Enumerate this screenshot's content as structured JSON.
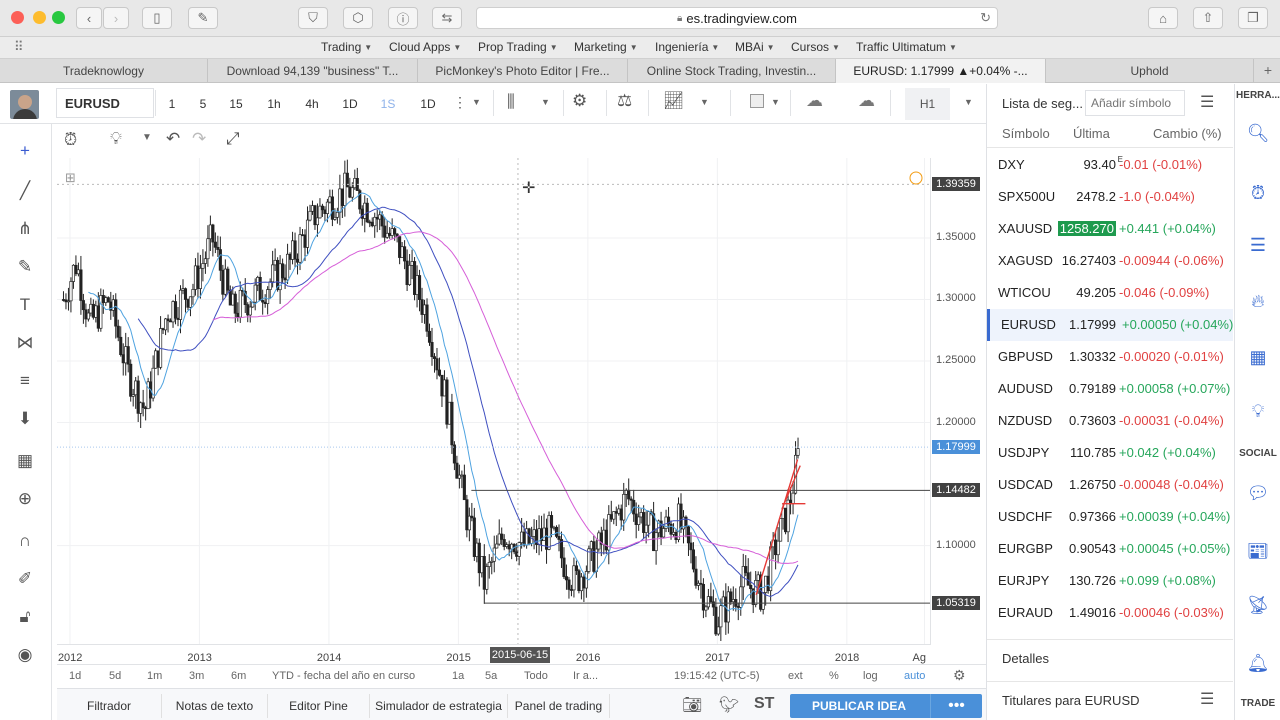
{
  "browser": {
    "url": "es.tradingview.com",
    "bookmarks": [
      {
        "label": "Trading"
      },
      {
        "label": "Cloud Apps"
      },
      {
        "label": "Prop Trading"
      },
      {
        "label": "Marketing"
      },
      {
        "label": "Ingeniería"
      },
      {
        "label": "MBAi"
      },
      {
        "label": "Cursos"
      },
      {
        "label": "Traffic Ultimatum"
      }
    ],
    "tabs": [
      {
        "label": "Tradeknowlogy"
      },
      {
        "label": "Download 94,139 \"business\" T..."
      },
      {
        "label": "PicMonkey's Photo Editor | Fre..."
      },
      {
        "label": "Online Stock Trading, Investin..."
      },
      {
        "label": "EURUSD: 1.17999 ▲+0.04% -..."
      },
      {
        "label": "Uphold"
      }
    ]
  },
  "toolbar": {
    "symbol": "EURUSD",
    "intervals": [
      "1",
      "5",
      "15",
      "1h",
      "4h",
      "1D",
      "1S",
      "1D"
    ],
    "active_interval": "1S",
    "timeframe_label": "H1"
  },
  "chart": {
    "price_labels": {
      "top": "1.39359",
      "current": "1.17999",
      "range_high": "1.14482",
      "range_low": "1.05319"
    },
    "y_ticks": [
      "1.35000",
      "1.30000",
      "1.25000",
      "1.20000",
      "1.10000"
    ],
    "y_values": [
      1.35,
      1.3,
      1.25,
      1.2,
      1.1
    ],
    "x_ticks": [
      "2012",
      "2013",
      "2014",
      "2015",
      "2016",
      "2017",
      "2018",
      "Ag"
    ],
    "x_values": [
      2012,
      2013,
      2014,
      2015,
      2016,
      2017,
      2018,
      2018.6
    ],
    "crosshair_date": "2015-06-15"
  },
  "range_bar": {
    "items": [
      "1d",
      "5d",
      "1m",
      "3m",
      "6m",
      "YTD - fecha del año en curso",
      "1a",
      "5a",
      "Todo",
      "Ir a..."
    ],
    "time": "19:15:42 (UTC-5)",
    "options": [
      "ext",
      "%",
      "log",
      "auto"
    ]
  },
  "bottom_tabs": [
    "Filtrador",
    "Notas de texto",
    "Editor Pine",
    "Simulador de estrategia",
    "Panel de trading"
  ],
  "publish_label": "PUBLICAR IDEA",
  "st_label": "ST",
  "watchlist": {
    "title": "Lista de seg...",
    "add_placeholder": "Añadir símbolo",
    "col_symbol": "Símbolo",
    "col_last": "Última",
    "col_change": "Cambio (%)",
    "rows": [
      {
        "sym": "DXY",
        "last": "93.40",
        "sup": "E",
        "chg": "-0.01 (-0.01%)",
        "dir": "neg"
      },
      {
        "sym": "SPX500U",
        "last": "2478.2",
        "sup": "",
        "chg": "-1.0 (-0.04%)",
        "dir": "neg"
      },
      {
        "sym": "XAUUSD",
        "last": "1258.270",
        "sup": "",
        "chg": "+0.441 (+0.04%)",
        "dir": "pos"
      },
      {
        "sym": "XAGUSD",
        "last": "16.27403",
        "sup": "",
        "chg": "-0.00944 (-0.06%)",
        "dir": "neg"
      },
      {
        "sym": "WTICOU",
        "last": "49.205",
        "sup": "",
        "chg": "-0.046 (-0.09%)",
        "dir": "neg"
      },
      {
        "sym": "EURUSD",
        "last": "1.17999",
        "sup": "",
        "chg": "+0.00050 (+0.04%)",
        "dir": "pos"
      },
      {
        "sym": "GBPUSD",
        "last": "1.30332",
        "sup": "",
        "chg": "-0.00020 (-0.01%)",
        "dir": "neg"
      },
      {
        "sym": "AUDUSD",
        "last": "0.79189",
        "sup": "",
        "chg": "+0.00058 (+0.07%)",
        "dir": "pos"
      },
      {
        "sym": "NZDUSD",
        "last": "0.73603",
        "sup": "",
        "chg": "-0.00031 (-0.04%)",
        "dir": "neg"
      },
      {
        "sym": "USDJPY",
        "last": "110.785",
        "sup": "",
        "chg": "+0.042 (+0.04%)",
        "dir": "pos"
      },
      {
        "sym": "USDCAD",
        "last": "1.26750",
        "sup": "",
        "chg": "-0.00048 (-0.04%)",
        "dir": "neg"
      },
      {
        "sym": "USDCHF",
        "last": "0.97366",
        "sup": "",
        "chg": "+0.00039 (+0.04%)",
        "dir": "pos"
      },
      {
        "sym": "EURGBP",
        "last": "0.90543",
        "sup": "",
        "chg": "+0.00045 (+0.05%)",
        "dir": "pos"
      },
      {
        "sym": "EURJPY",
        "last": "130.726",
        "sup": "",
        "chg": "+0.099 (+0.08%)",
        "dir": "pos"
      },
      {
        "sym": "EURAUD",
        "last": "1.49016",
        "sup": "",
        "chg": "-0.00046 (-0.03%)",
        "dir": "neg"
      }
    ],
    "details_label": "Detalles",
    "headlines_label": "Titulares para EURUSD"
  },
  "rail": {
    "top_label": "HERRA...",
    "social_label": "SOCIAL",
    "trade_label": "TRADE"
  },
  "colors": {
    "accent": "#3a6bd0",
    "pos": "#26a65b",
    "neg": "#e04141",
    "publish": "#4a90d9",
    "highlight_bg": "#1e9a4e"
  }
}
